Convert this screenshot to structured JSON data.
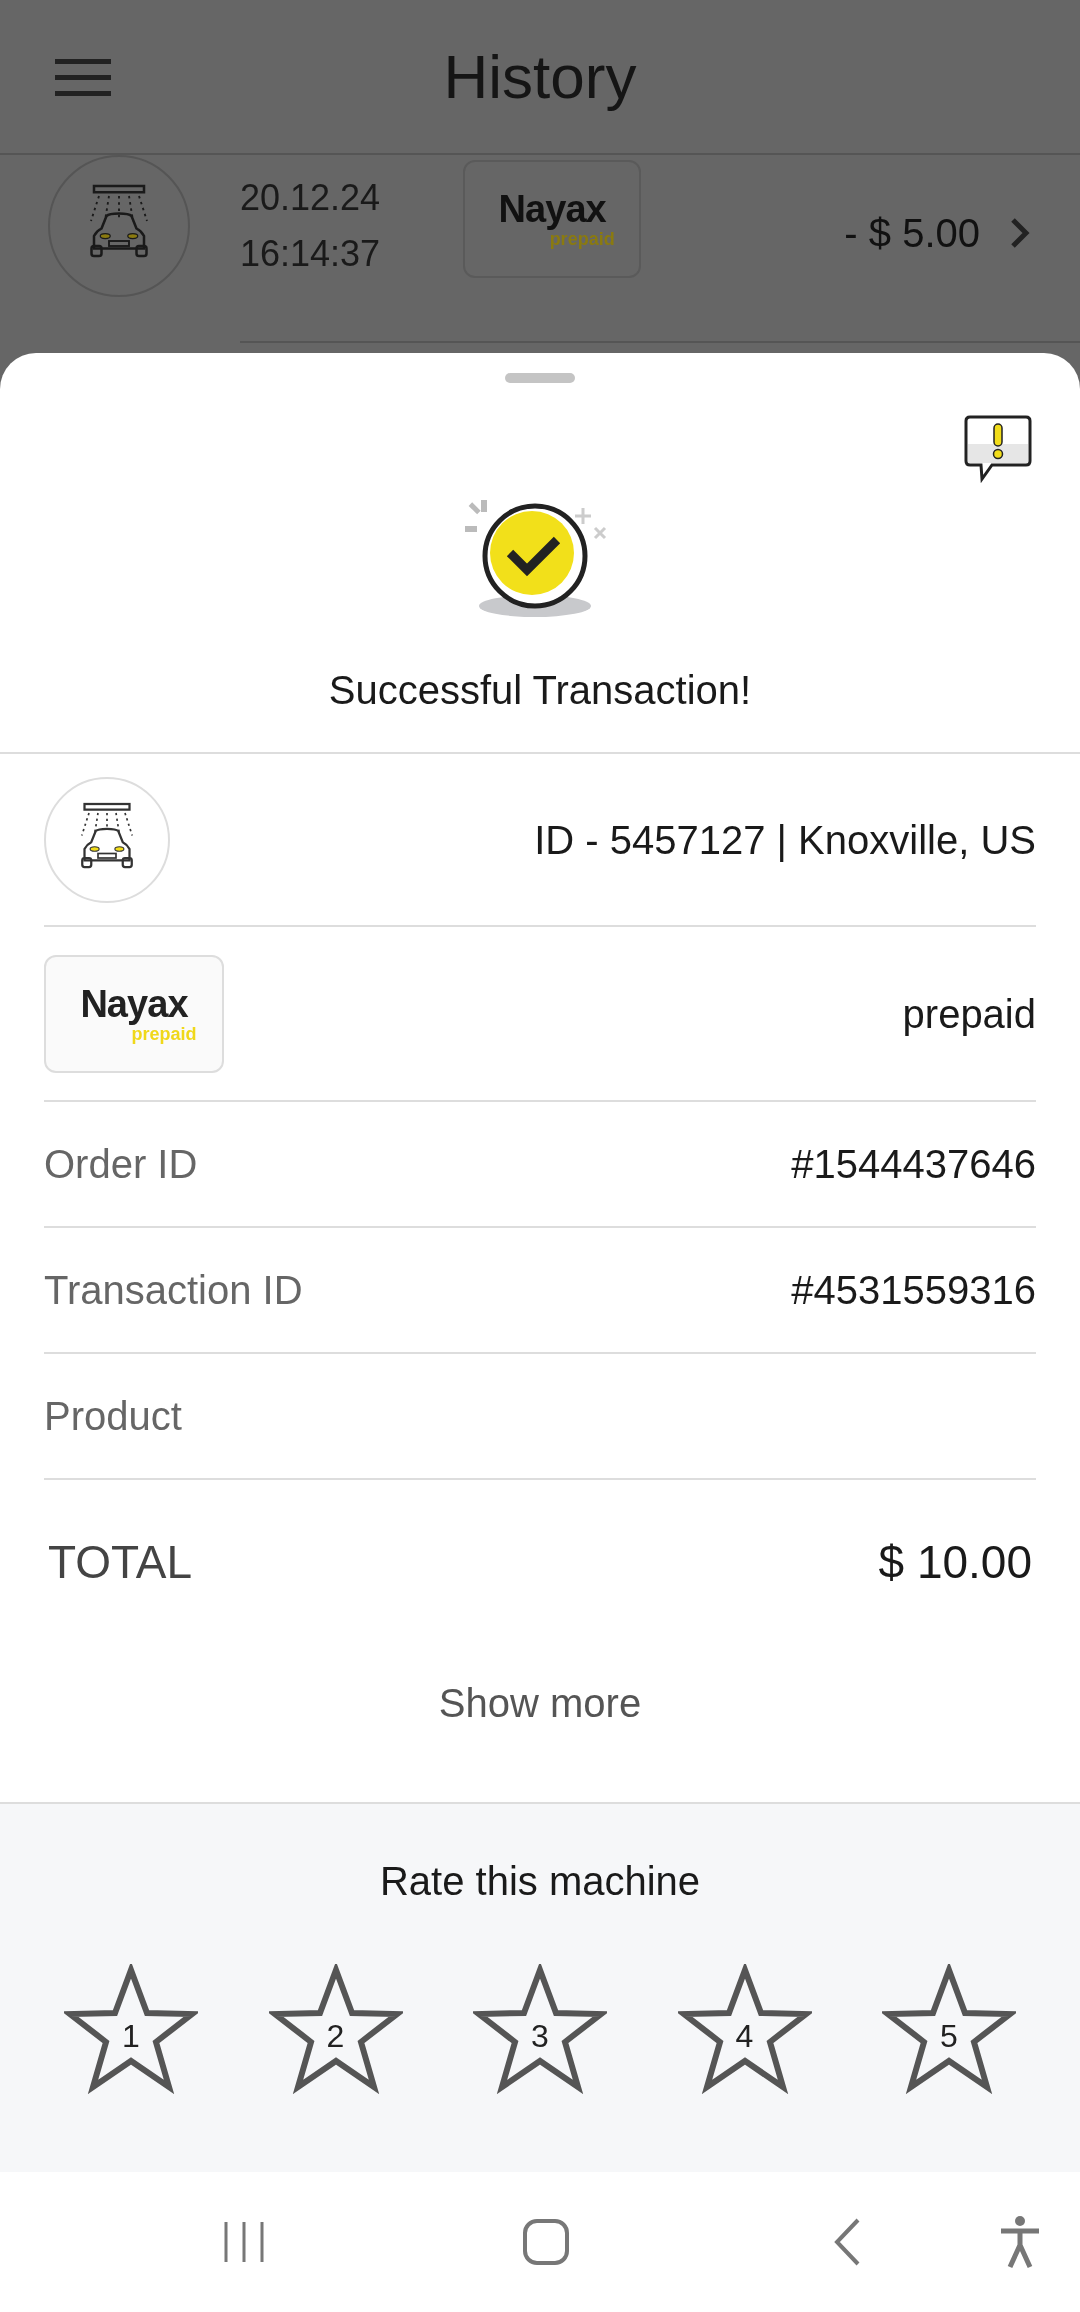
{
  "header": {
    "title": "History"
  },
  "history_row": {
    "date": "20.12.24",
    "time": "16:14:37",
    "logo": {
      "name": "Nayax",
      "sub": "prepaid"
    },
    "amount": "- $ 5.00"
  },
  "sheet": {
    "status": "Successful Transaction!",
    "machine": "ID - 5457127 | Knoxville, US",
    "payment": {
      "logo": {
        "name": "Nayax",
        "sub": "prepaid"
      },
      "method": "prepaid"
    },
    "details": [
      {
        "label": "Order ID",
        "value": "#1544437646"
      },
      {
        "label": "Transaction ID",
        "value": "#4531559316"
      },
      {
        "label": "Product"
      }
    ],
    "total": {
      "label": "TOTAL",
      "value": "$ 10.00"
    },
    "show_more": "Show more"
  },
  "rating": {
    "title": "Rate this machine",
    "stars": 0,
    "labels": [
      "1",
      "2",
      "3",
      "4",
      "5"
    ]
  }
}
